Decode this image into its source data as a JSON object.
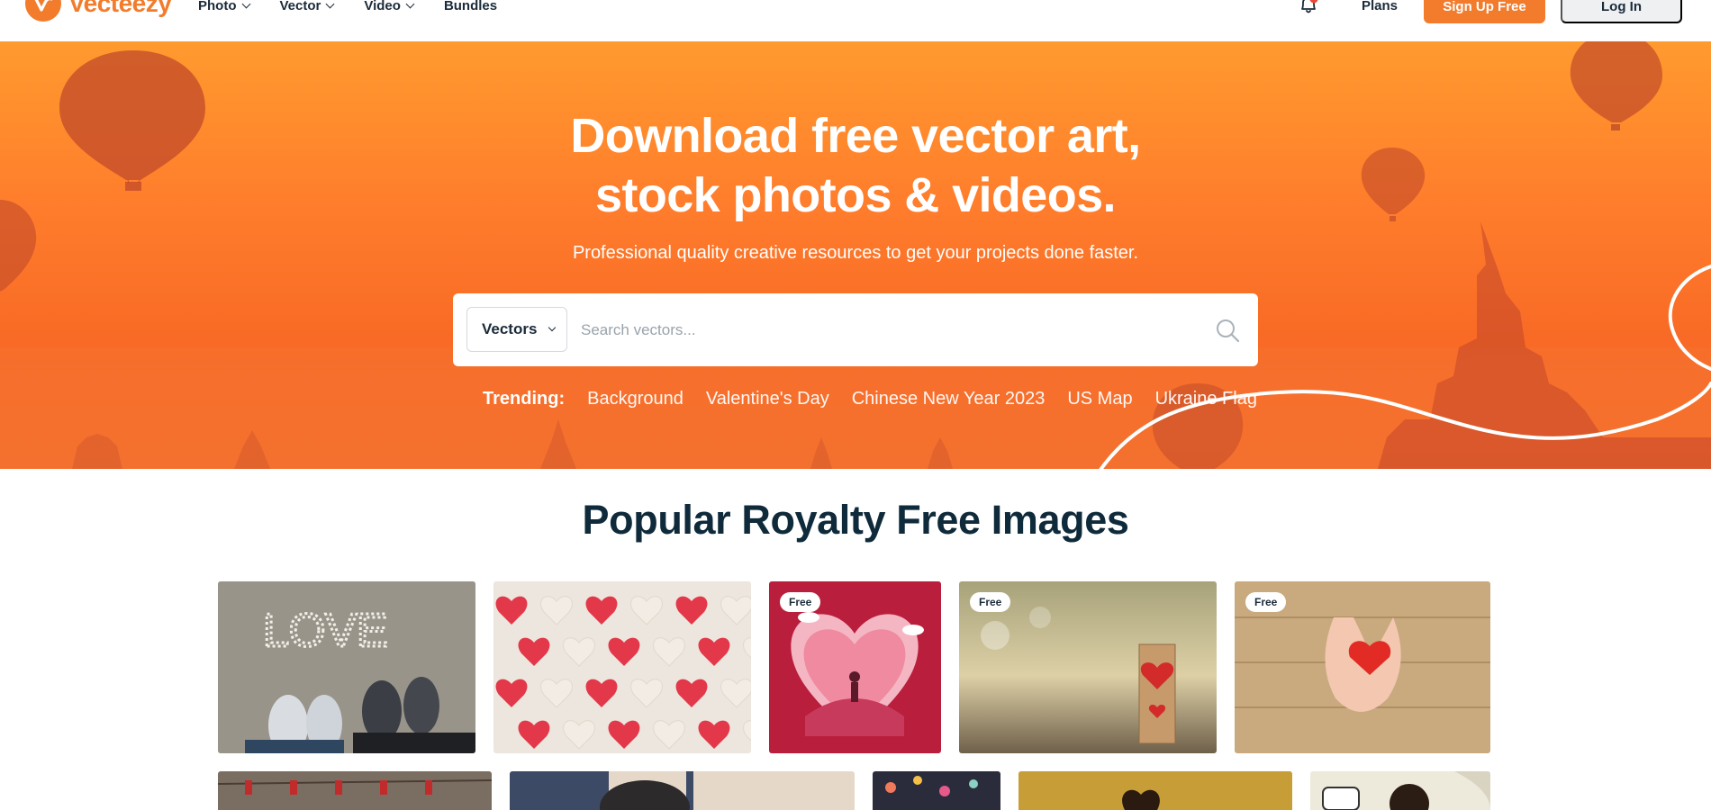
{
  "header": {
    "logo_text": "Vecteezy",
    "nav": [
      {
        "label": "Photo",
        "has_dropdown": true
      },
      {
        "label": "Vector",
        "has_dropdown": true
      },
      {
        "label": "Video",
        "has_dropdown": true
      },
      {
        "label": "Bundles",
        "has_dropdown": false
      }
    ],
    "bell_icon": "bell-icon",
    "plans_label": "Plans",
    "signup_label": "Sign Up Free",
    "login_label": "Log In"
  },
  "hero": {
    "title_line1": "Download free vector art,",
    "title_line2": "stock photos & videos.",
    "subtitle": "Professional quality creative resources to get your projects done faster.",
    "search": {
      "type_selected": "Vectors",
      "placeholder": "Search vectors...",
      "value": ""
    },
    "trending_label": "Trending:",
    "trending": [
      "Background",
      "Valentine's Day",
      "Chinese New Year 2023",
      "US Map",
      "Ukraine Flag"
    ]
  },
  "popular": {
    "title": "Popular Royalty Free Images",
    "row1": [
      {
        "subject": "love-pebbles-shoes",
        "badge": ""
      },
      {
        "subject": "heart-candies",
        "badge": ""
      },
      {
        "subject": "paper-heart-couple",
        "badge": "Free"
      },
      {
        "subject": "wooden-heart-blocks",
        "badge": "Free"
      },
      {
        "subject": "hands-holding-heart",
        "badge": "Free"
      }
    ]
  },
  "colors": {
    "brand": "#f27c2c",
    "hero_top": "#ff9a2e",
    "hero_bottom": "#f56d2a",
    "title_text": "#0f2a3a"
  }
}
